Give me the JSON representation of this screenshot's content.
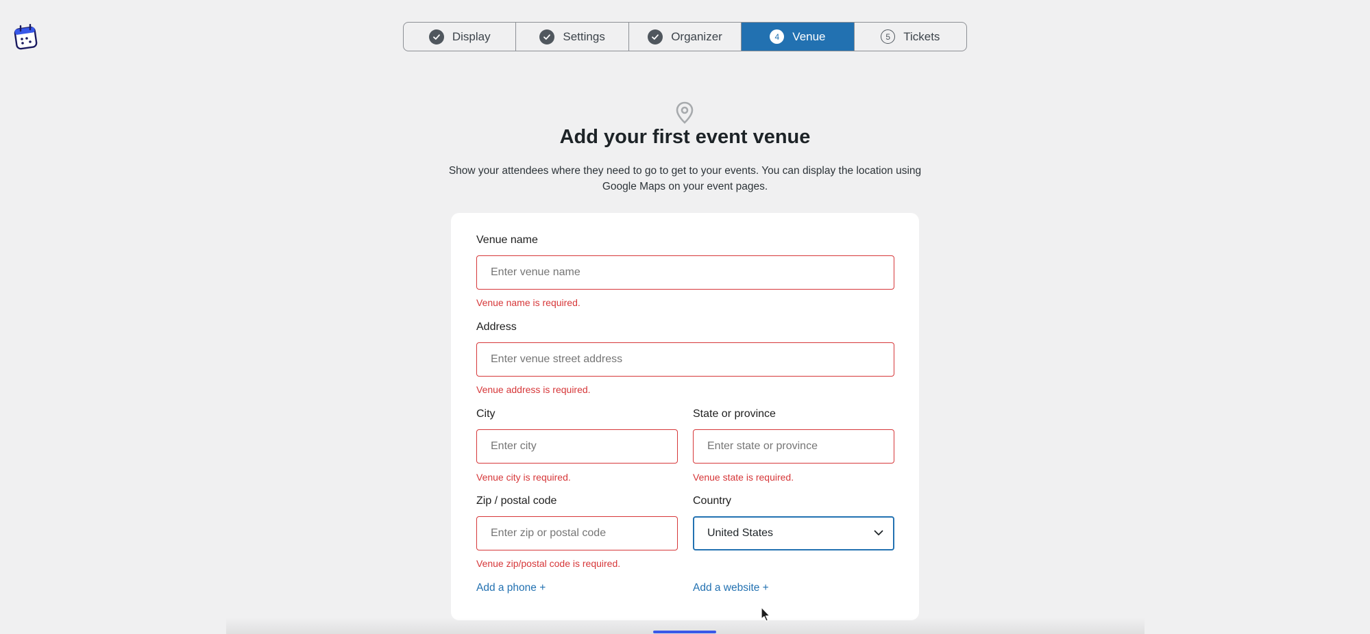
{
  "steps": [
    {
      "label": "Display",
      "state": "done"
    },
    {
      "label": "Settings",
      "state": "done"
    },
    {
      "label": "Organizer",
      "state": "done"
    },
    {
      "label": "Venue",
      "number": "4",
      "state": "active"
    },
    {
      "label": "Tickets",
      "number": "5",
      "state": "todo"
    }
  ],
  "header": {
    "title": "Add your first event venue",
    "description": "Show your attendees where they need to go to get to your events. You can display the location using Google Maps on your event pages."
  },
  "form": {
    "venue_name": {
      "label": "Venue name",
      "placeholder": "Enter venue name",
      "value": "",
      "error": "Venue name is required."
    },
    "address": {
      "label": "Address",
      "placeholder": "Enter venue street address",
      "value": "",
      "error": "Venue address is required."
    },
    "city": {
      "label": "City",
      "placeholder": "Enter city",
      "value": "",
      "error": "Venue city is required."
    },
    "state": {
      "label": "State or province",
      "placeholder": "Enter state or province",
      "value": "",
      "error": "Venue state is required."
    },
    "zip": {
      "label": "Zip / postal code",
      "placeholder": "Enter zip or postal code",
      "value": "",
      "error": "Venue zip/postal code is required."
    },
    "country": {
      "label": "Country",
      "value": "United States"
    },
    "add_phone": "Add a phone +",
    "add_website": "Add a website +"
  },
  "colors": {
    "accent": "#2271b1",
    "error": "#d63638",
    "background": "#f0f0f1"
  }
}
